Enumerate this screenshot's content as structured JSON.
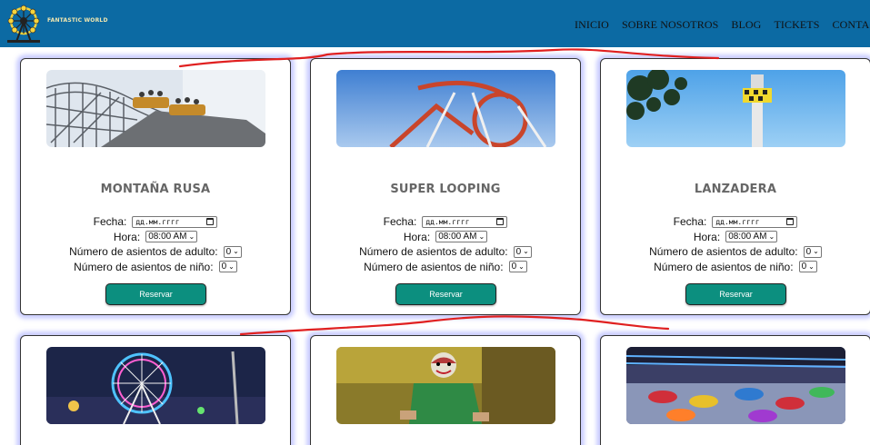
{
  "header": {
    "brand": "FANTASTIC WORLD",
    "nav": [
      "INICIO",
      "SOBRE NOSOTROS",
      "BLOG",
      "TICKETS",
      "CONTACT"
    ],
    "bg_color": "#0c6aa3"
  },
  "form_labels": {
    "date": "Fecha:",
    "time": "Hora:",
    "adults": "Número de asientos de adulto:",
    "kids": "Número de asientos de niño:"
  },
  "form_values": {
    "date_placeholder": "дд.мм.гггг",
    "time": "08:00 AM",
    "adults": "0",
    "kids": "0"
  },
  "button_label": "Reservar",
  "accent_color": "#0c8f7f",
  "rides": [
    {
      "title": "MONTAÑA RUSA"
    },
    {
      "title": "SUPER LOOPING"
    },
    {
      "title": "LANZADERA"
    }
  ]
}
